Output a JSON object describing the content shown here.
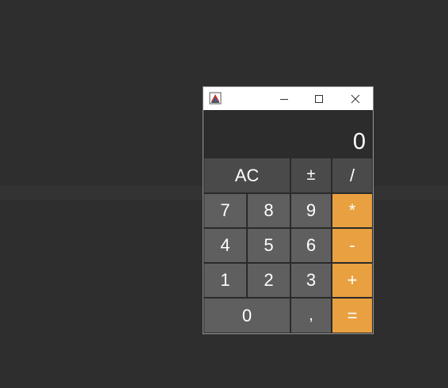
{
  "display": {
    "value": "0"
  },
  "keys": {
    "ac": "AC",
    "plus_minus": "±",
    "divide": "/",
    "seven": "7",
    "eight": "8",
    "nine": "9",
    "multiply": "*",
    "four": "4",
    "five": "5",
    "six": "6",
    "minus": "-",
    "one": "1",
    "two": "2",
    "three": "3",
    "plus": "+",
    "zero": "0",
    "comma": ",",
    "equals": "="
  },
  "colors": {
    "operator": "#e9a040",
    "number_key": "#5f5f5f",
    "function_key": "#4a4a4a",
    "display_bg": "#2c2c2c",
    "desktop": "#2e2e2e"
  }
}
